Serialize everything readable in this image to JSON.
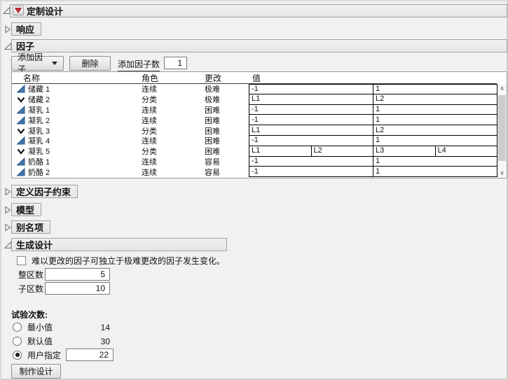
{
  "colors": {
    "continuous_icon": "#4377ad",
    "continuous_icon_border": "#2a5788",
    "categorical_icon": "#1a1a1a",
    "red_triangle": "#d22b2b"
  },
  "root": {
    "title": "定制设计"
  },
  "responses": {
    "title": "响应"
  },
  "factors": {
    "title": "因子",
    "toolbar": {
      "add_factor": "添加因子",
      "remove": "删除",
      "add_n_label": "添加因子数",
      "add_n_value": "1"
    },
    "table": {
      "headers": {
        "name": "名称",
        "role": "角色",
        "changes": "更改",
        "values": "值"
      },
      "rows": [
        {
          "icon": "continuous",
          "name": "储藏 1",
          "role": "连续",
          "changes": "极难",
          "values": [
            "-1",
            "1"
          ]
        },
        {
          "icon": "categorical",
          "name": "储藏 2",
          "role": "分类",
          "changes": "极难",
          "values": [
            "L1",
            "L2"
          ]
        },
        {
          "icon": "continuous",
          "name": "凝乳 1",
          "role": "连续",
          "changes": "困难",
          "values": [
            "-1",
            "1"
          ]
        },
        {
          "icon": "continuous",
          "name": "凝乳 2",
          "role": "连续",
          "changes": "困难",
          "values": [
            "-1",
            "1"
          ]
        },
        {
          "icon": "categorical",
          "name": "凝乳 3",
          "role": "分类",
          "changes": "困难",
          "values": [
            "L1",
            "L2"
          ]
        },
        {
          "icon": "continuous",
          "name": "凝乳 4",
          "role": "连续",
          "changes": "困难",
          "values": [
            "-1",
            "1"
          ]
        },
        {
          "icon": "categorical",
          "name": "凝乳 5",
          "role": "分类",
          "changes": "困难",
          "values": [
            "L1",
            "L2",
            "L3",
            "L4"
          ]
        },
        {
          "icon": "continuous",
          "name": "奶酪 1",
          "role": "连续",
          "changes": "容易",
          "values": [
            "-1",
            "1"
          ]
        },
        {
          "icon": "continuous",
          "name": "奶酪 2",
          "role": "连续",
          "changes": "容易",
          "values": [
            "-1",
            "1"
          ]
        }
      ]
    }
  },
  "constraints": {
    "title": "定义因子约束"
  },
  "model": {
    "title": "模型"
  },
  "alias": {
    "title": "别名项"
  },
  "design_generation": {
    "title": "生成设计",
    "hard_checkbox_label": "难以更改的因子可独立于极难更改的因子发生变化。",
    "whole_plots": {
      "label": "整区数",
      "value": "5"
    },
    "subplots": {
      "label": "子区数",
      "value": "10"
    },
    "runs": {
      "label": "试验次数:",
      "options": [
        {
          "label": "最小值",
          "value": "14",
          "selected": false
        },
        {
          "label": "默认值",
          "value": "30",
          "selected": false
        },
        {
          "label": "用户指定",
          "value": "22",
          "selected": true
        }
      ]
    },
    "make_design": "制作设计"
  }
}
